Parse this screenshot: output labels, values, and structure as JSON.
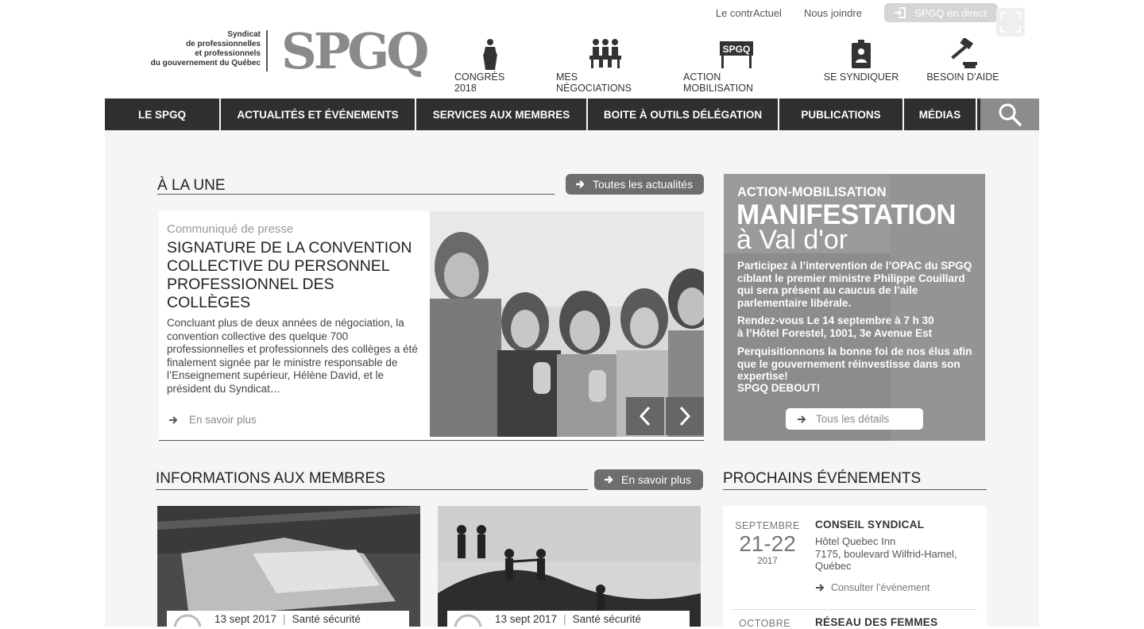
{
  "top_links": {
    "contractuel": "Le contrActuel",
    "contact": "Nous joindre",
    "live": "SPGQ en direct"
  },
  "logo": {
    "line1": "Syndicat",
    "line2": "de professionnelles",
    "line3": "et professionnels",
    "line4": "du gouvernement du Québec",
    "mark": "SPGQ"
  },
  "quick_links": [
    {
      "label": "CONGRÈS 2018",
      "icon": "speaker-podium-icon"
    },
    {
      "label": "MES NÉGOCIATIONS",
      "icon": "negotiation-table-icon"
    },
    {
      "label": "ACTION MOBILISATION",
      "icon": "spgq-sign-icon",
      "sign_text": "SPGQ"
    },
    {
      "label": "SE SYNDIQUER",
      "icon": "badge-icon"
    },
    {
      "label": "BESOIN D'AIDE",
      "icon": "gavel-icon"
    }
  ],
  "nav": [
    {
      "label": "LE SPGQ"
    },
    {
      "label": "ACTUALITÉS ET ÉVÉNEMENTS"
    },
    {
      "label": "SERVICES AUX MEMBRES"
    },
    {
      "label": "BOITE À OUTILS DÉLÉGATION"
    },
    {
      "label": "PUBLICATIONS"
    },
    {
      "label": "MÉDIAS"
    }
  ],
  "une": {
    "title": "À LA UNE",
    "all_news": "Toutes les actualités",
    "kicker": "Communiqué de presse",
    "headline": "SIGNATURE DE LA CONVENTION COLLECTIVE DU PERSONNEL PROFESSIONNEL DES COLLÈGES",
    "excerpt": "Concluant plus de deux années de négociation, la convention collective des quelque 700 professionnelles et professionnels des collèges a été finalement signée par le ministre responsable de l’Enseignement supérieur, Hélène David, et le président du Syndicat…",
    "more": "En savoir plus"
  },
  "promo": {
    "kicker": "ACTION-MOBILISATION",
    "big1": "MANIFESTATION",
    "big2": "à Val d'or",
    "p1": "Participez à l’intervention de l’OPAC du SPGQ ciblant le premier ministre Philippe Couillard qui sera présent au caucus de l’aile parlementaire libérale.",
    "p2a": "Rendez-vous ",
    "p2b": "Le 14 septembre à 7 h 30",
    "p2c": "à l’Hôtel Forestel, 1001, 3e Avenue Est",
    "p3": "Perquisitionnons la bonne foi de nos élus afin que le gouvernement réinvestisse dans son expertise!",
    "p4": "SPGQ DEBOUT!",
    "btn": "Tous les détails"
  },
  "members": {
    "title": "INFORMATIONS AUX MEMBRES",
    "more": "En savoir plus",
    "cards": [
      {
        "date": "13 sept 2017",
        "category": "Santé sécurité"
      },
      {
        "date": "13 sept 2017",
        "category": "Santé sécurité"
      }
    ]
  },
  "events": {
    "title": "PROCHAINS ÉVÉNEMENTS",
    "items": [
      {
        "month": "SEPTEMBRE",
        "days": "21-22",
        "year": "2017",
        "title": "CONSEIL  SYNDICAL",
        "addr1": "Hôtel Quebec Inn",
        "addr2": "7175, boulevard Wilfrid-Hamel,",
        "addr3": "Québec",
        "link": "Consulter  l’événement"
      },
      {
        "month": "OCTOBRE",
        "title": "RÉSEAU DES FEMMES"
      }
    ]
  }
}
